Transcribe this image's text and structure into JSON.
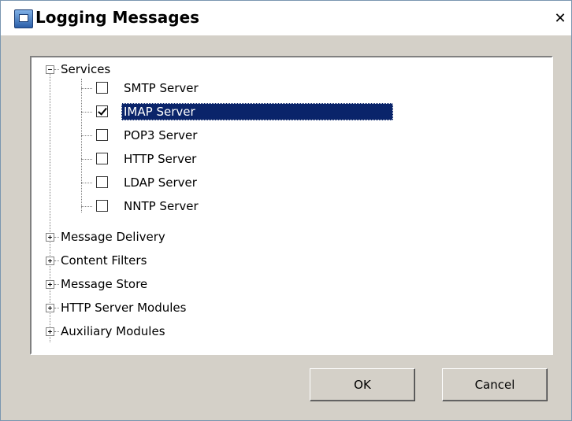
{
  "window": {
    "title": "Logging Messages",
    "icon": "app-window-icon",
    "close_glyph": "✕"
  },
  "tree": {
    "root": {
      "label": "Services",
      "expanded": true
    },
    "services": [
      {
        "label": "SMTP Server",
        "checked": false,
        "selected": false
      },
      {
        "label": "IMAP Server",
        "checked": true,
        "selected": true
      },
      {
        "label": "POP3 Server",
        "checked": false,
        "selected": false
      },
      {
        "label": "HTTP Server",
        "checked": false,
        "selected": false
      },
      {
        "label": "LDAP Server",
        "checked": false,
        "selected": false
      },
      {
        "label": "NNTP Server",
        "checked": false,
        "selected": false
      }
    ],
    "groups": [
      {
        "label": "Message Delivery",
        "expanded": false
      },
      {
        "label": "Content Filters",
        "expanded": false
      },
      {
        "label": "Message Store",
        "expanded": false
      },
      {
        "label": "HTTP Server Modules",
        "expanded": false
      },
      {
        "label": "Auxiliary Modules",
        "expanded": false
      }
    ]
  },
  "buttons": {
    "ok_label": "OK",
    "cancel_label": "Cancel"
  },
  "colors": {
    "selection": "#0a246a",
    "dialog_bg": "#d4d0c8"
  }
}
